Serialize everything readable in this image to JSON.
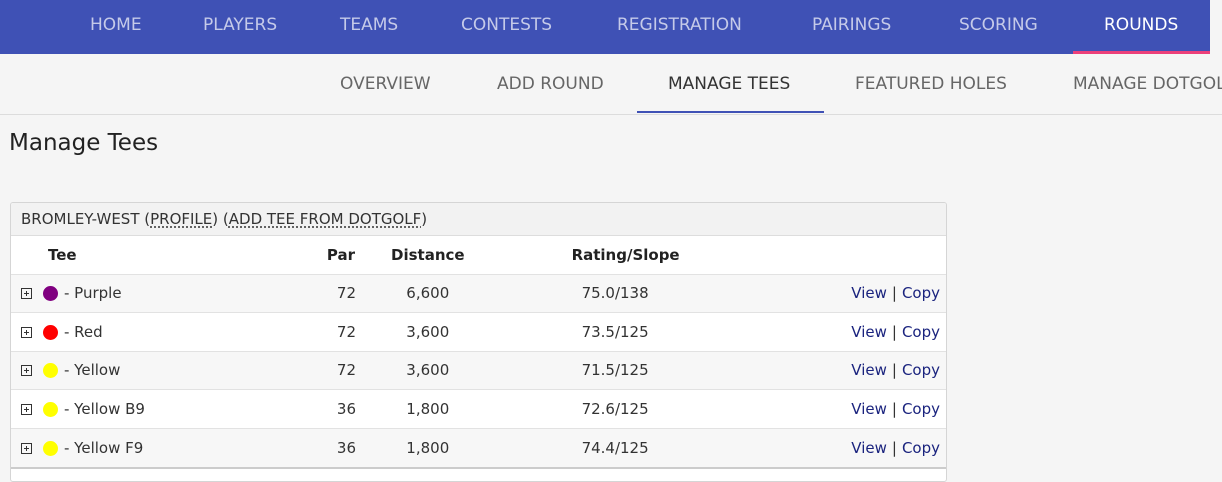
{
  "topnav": {
    "items": [
      {
        "label": "HOME"
      },
      {
        "label": "PLAYERS"
      },
      {
        "label": "TEAMS"
      },
      {
        "label": "CONTESTS"
      },
      {
        "label": "REGISTRATION"
      },
      {
        "label": "PAIRINGS"
      },
      {
        "label": "SCORING"
      },
      {
        "label": "ROUNDS"
      }
    ],
    "active": "ROUNDS",
    "active_color": "#ec407a",
    "background": "#3f51b5"
  },
  "subnav": {
    "items": [
      {
        "label": "OVERVIEW"
      },
      {
        "label": "ADD ROUND"
      },
      {
        "label": "MANAGE TEES"
      },
      {
        "label": "FEATURED HOLES"
      },
      {
        "label": "MANAGE DOTGOLF"
      }
    ],
    "active": "MANAGE TEES"
  },
  "page": {
    "title": "Manage Tees"
  },
  "course": {
    "name": "BROMLEY-WEST",
    "profile_link": "PROFILE",
    "add_tee_link": "ADD TEE FROM DOTGOLF"
  },
  "table": {
    "headers": {
      "tee": "Tee",
      "par": "Par",
      "distance": "Distance",
      "rating_slope": "Rating/Slope"
    },
    "rows": [
      {
        "name": "- Purple",
        "color": "#800080",
        "par": "72",
        "distance": "6,600",
        "rating_slope": "75.0/138",
        "view": "View",
        "sep": "|",
        "copy": "Copy"
      },
      {
        "name": "- Red",
        "color": "#ff0000",
        "par": "72",
        "distance": "3,600",
        "rating_slope": "73.5/125",
        "view": "View",
        "sep": "|",
        "copy": "Copy"
      },
      {
        "name": "- Yellow",
        "color": "#ffff00",
        "par": "72",
        "distance": "3,600",
        "rating_slope": "71.5/125",
        "view": "View",
        "sep": "|",
        "copy": "Copy"
      },
      {
        "name": "- Yellow B9",
        "color": "#ffff00",
        "par": "36",
        "distance": "1,800",
        "rating_slope": "72.6/125",
        "view": "View",
        "sep": "|",
        "copy": "Copy"
      },
      {
        "name": "- Yellow F9",
        "color": "#ffff00",
        "par": "36",
        "distance": "1,800",
        "rating_slope": "74.4/125",
        "view": "View",
        "sep": "|",
        "copy": "Copy"
      }
    ]
  }
}
